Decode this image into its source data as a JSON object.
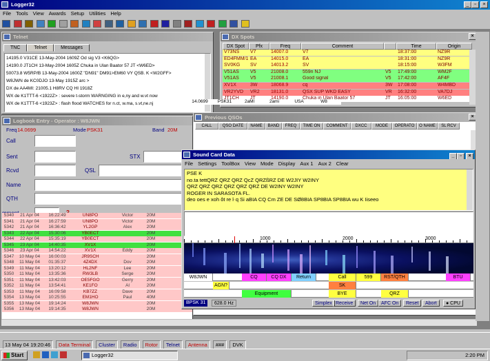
{
  "app": {
    "title": "Logger32",
    "menu": [
      "File",
      "Tools",
      "View",
      "Awards",
      "Setup",
      "Utilities",
      "Help"
    ]
  },
  "telnet": {
    "title": "Telnet",
    "tabs": [
      "TNC",
      "Telnet",
      "Messages"
    ],
    "lines": [
      "14195.0  V31CE     13-May-2004 1609Z  Od sig                     V3 <K6QG>",
      "14190.0  JT1CH     13-May-2004 1605Z  Chuka in Ulan Baator 57   JT <W6ED>",
      "50073.8  W5RP/B    13-May-2004 1600Z  \"DN91\" DM91>EM60 VY QSB. K <W2GFF>",
      "W8JWN de KC0DJO   13-May 1915Z arc >",
      "DX de AA4MI:    21005.1  H8RV          CQ                      HI 1918Z",
      "WX de K1TTT-6 <1922Z> : severe t-storm WARNGING in e,ny and w.vt now",
      "WX de K1TTT-6 <1923Z> : flash flood WATCHES for n.ct, w.ma, s.vt,ne.nj"
    ]
  },
  "dxspots": {
    "title": "DX Spots",
    "columns": [
      "DX Spot",
      "Pfx",
      "Freq",
      "Comment",
      "Time",
      "Origin"
    ],
    "rows": [
      [
        "V73NS",
        "V7",
        "14007.0",
        "V7",
        "",
        "18:37:00",
        "NZ9R"
      ],
      [
        "ED4FMM/1",
        "EA",
        "14015.0",
        "EA",
        "",
        "18:31:00",
        "NZ9R"
      ],
      [
        "SV0KG",
        "SV",
        "14013.2",
        "SV",
        "",
        "18:15:00",
        "W3FM"
      ],
      [
        "V51AS",
        "V5",
        "21008.0",
        "559n NJ",
        "V5",
        "17:49:00",
        "WM2F"
      ],
      [
        "V51AS",
        "V5",
        "21008.1",
        "Good signal",
        "V5",
        "17:42:00",
        "AF4F"
      ],
      [
        "XV1X",
        "3W",
        "18068.9",
        "cq",
        "3W",
        "17:08:00",
        "W4MBD"
      ],
      [
        "VR2YVD",
        "VR2",
        "18131.0",
        "QSX SUP WKD EASY",
        "VR",
        "16:32:00",
        "VA7DJ"
      ],
      [
        "JT1CH",
        "JT",
        "14190.0",
        "Chuka in Ulan Baator 57",
        "JT",
        "16:05:00",
        "W6ED"
      ]
    ],
    "colors": [
      "#ffff80",
      "#ffff80",
      "#ffff80",
      "#80ff80",
      "#80ff80",
      "#ff8080",
      "#ff8080",
      "#ffffff"
    ]
  },
  "logbook": {
    "title": "Logbook Entry - Operator : W8JWN",
    "freq_label": "Freq",
    "freq": "14.0699",
    "mode_label": "Mode",
    "mode": "PSK31",
    "band_label": "Band",
    "band": "20M",
    "labels": [
      "Call",
      "Sent",
      "Rcvd",
      "Name",
      "QTH",
      "mment"
    ],
    "stx": "STX",
    "qsl": "QSL",
    "rows": [
      [
        "5340",
        "21 Apr 04",
        "16:22:49",
        "UN8PO",
        "Victor",
        "20M"
      ],
      [
        "5341",
        "21 Apr 04",
        "16:27:59",
        "UN8PO",
        "Victor",
        "20M"
      ],
      [
        "5342",
        "21 Apr 04",
        "16:36:42",
        "YL2GP",
        "Alex",
        "20M"
      ],
      [
        "5343",
        "22 Apr 04",
        "15:30:06",
        "YB0ECT",
        "",
        "20M"
      ],
      [
        "5344",
        "22 Apr 04",
        "15:35:19",
        "YB0ECT",
        "",
        "20M"
      ],
      [
        "5345",
        "23 Apr 04",
        "14:40:35",
        "XV1X",
        "",
        "20M"
      ],
      [
        "5346",
        "23 Apr 04",
        "14:54:22",
        "XV1X",
        "Eddy",
        "20M"
      ],
      [
        "5347",
        "10 May 04",
        "16:00:03",
        "JR9SCH",
        "",
        "20M"
      ],
      [
        "5348",
        "11 May 04",
        "01:35:37",
        "4Z4DX",
        "Dov",
        "20M"
      ],
      [
        "5349",
        "11 May 04",
        "13:20:12",
        "HL2NF",
        "Lee",
        "20M"
      ],
      [
        "5350",
        "11 May 04",
        "13:35:36",
        "RW3LB",
        "Serge",
        "20M"
      ],
      [
        "5351",
        "11 May 04",
        "13:42:03",
        "OE5FGO",
        "Gerry",
        "20M"
      ],
      [
        "5352",
        "11 May 04",
        "13:54:41",
        "KE1FO",
        "Al",
        "20M"
      ],
      [
        "5353",
        "11 May 04",
        "16:09:58",
        "KB7ZZ",
        "Dave",
        "20M"
      ],
      [
        "5354",
        "13 May 04",
        "10:25:55",
        "EM1HO",
        "Paul",
        "40M"
      ],
      [
        "5355",
        "13 May 04",
        "19:14:24",
        "W8JWN",
        "",
        "20M"
      ],
      [
        "5356",
        "13 May 04",
        "19:14:35",
        "W8JWN",
        "",
        "20M"
      ]
    ],
    "extra": [
      [
        "14.0699",
        "PSK31",
        "2aMl",
        "2ami",
        "USA",
        "W8"
      ]
    ]
  },
  "prevqso": {
    "title": "Previous QSOs",
    "columns": [
      "CALL",
      "QSO DATE",
      "NAME",
      "BAND",
      "FREQ",
      "TIME ON",
      "COMMENT",
      "DXCC",
      "MODE",
      "OPERATO",
      "O NAME",
      "SL RCV"
    ]
  },
  "sound": {
    "title": "Sound Card Data",
    "menu": [
      "File",
      "Settings",
      "ToolBox",
      "View",
      "Mode",
      "Display",
      "Aux 1",
      "Aux 2",
      "Clear"
    ],
    "rx": [
      "PSE K",
      "no.ta tettQRZ  QRZ QRZ QcZ QRZßRZ DE W2JIY W2INY",
      "QRZ  QRZ QRZ QRZ QRZ QRZ DE W2INY W2INY",
      "ROGER IN SARASOTA FL.",
      "  deo oes  e xoh  ôt re  ŀ q Si  aBIA               CQ Cm ZE DE SØ8BIA SP8BIA SP8BIA wu K                Iiseeo"
    ],
    "scale": [
      "1000",
      "2000",
      "3000"
    ],
    "macros": [
      [
        "W8JWN",
        "CQ",
        "CQ DX",
        "Return",
        "Call",
        "599",
        "RST/QTH",
        "BTU"
      ],
      [
        "AGN?",
        "SK"
      ],
      [
        "Equipment",
        "BYE",
        "QRZ"
      ]
    ],
    "mode": "BPSK 31",
    "hz": "628.0 Hz",
    "status": [
      "Simplex",
      "Receive",
      "Net On",
      "AFC On",
      "Reset",
      "Abort",
      "CPU"
    ]
  },
  "statusbar": {
    "time": "13 May 04  19:20:46",
    "tabs": [
      "Data Terminal",
      "Cluster",
      "Radio",
      "Rotor",
      "Telnet",
      "Antenna",
      "###",
      "DVK"
    ]
  },
  "taskbar": {
    "start": "Start",
    "task": "Logger32",
    "clock": "2:20 PM"
  }
}
